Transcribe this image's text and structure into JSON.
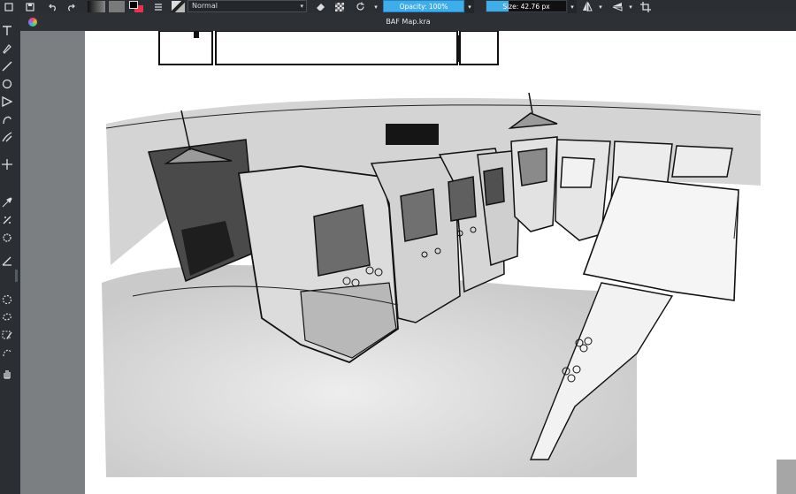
{
  "toolbar": {
    "blend_mode": "Normal",
    "opacity_label": "Opacity: 100%",
    "opacity_value": 1.0,
    "size_label": "Size: 42.76 px",
    "size_fraction": 0.28,
    "icons": [
      "new-document-icon",
      "save-icon",
      "undo-icon",
      "redo-icon",
      "gradient-icon",
      "pattern-icon",
      "color-swatch-icon",
      "preset-list-icon",
      "brush-preset-icon",
      "eraser-icon",
      "alpha-lock-icon",
      "reload-icon",
      "mirror-horizontal-icon",
      "mirror-vertical-icon",
      "wrap-icon"
    ]
  },
  "document": {
    "title": "BAF Map.kra"
  },
  "toolbox": {
    "tools": [
      "text-tool-icon",
      "calligraphy-tool-icon",
      "line-tool-icon",
      "ellipse-tool-icon",
      "polygon-tool-icon",
      "bezier-tool-icon",
      "dynamic-brush-icon",
      "move-tool-icon",
      "color-picker-icon",
      "smart-patch-icon",
      "assistant-tool-icon",
      "measure-tool-icon",
      "elliptical-select-icon",
      "freehand-select-icon",
      "similar-select-icon",
      "bezier-select-icon",
      "pan-tool-icon"
    ]
  },
  "colors": {
    "accent": "#3daee9",
    "panel": "#2b2f33",
    "canvas_frame": "#7c7f82",
    "foreground_swatch": "#000000",
    "background_swatch": "#e0364f"
  }
}
